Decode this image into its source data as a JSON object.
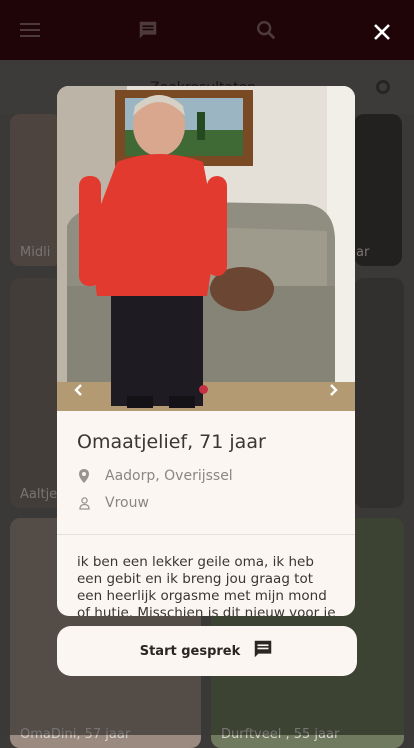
{
  "topbar": {
    "menu_icon": "menu-icon",
    "chat_icon": "chat-icon",
    "search_icon": "search-icon",
    "close_icon": "close-icon"
  },
  "background": {
    "header_label": "Zoekresultaten",
    "cards": [
      {
        "caption": "Midli"
      },
      {
        "caption": "ar"
      },
      {
        "caption": "Aaltje"
      },
      {
        "caption": "OmaDini, 57 jaar"
      },
      {
        "caption": "Durftveel , 55 jaar"
      }
    ]
  },
  "profile": {
    "name_age": "Omaatjelief, 71 jaar",
    "location": "Aadorp, Overijssel",
    "gender": "Vrouw",
    "bio": "ik ben een lekker geile oma, ik heb een gebit en ik breng jou graag tot een heerlijk orgasme met mijn mond of hutje. Misschien is dit nieuw voor je",
    "photo_index": 1,
    "photo_count": 1
  },
  "actions": {
    "start_chat_label": "Start gesprek"
  },
  "colors": {
    "topbar": "#3a0a10",
    "accent": "#c53044",
    "panel": "#fbf6f1"
  }
}
